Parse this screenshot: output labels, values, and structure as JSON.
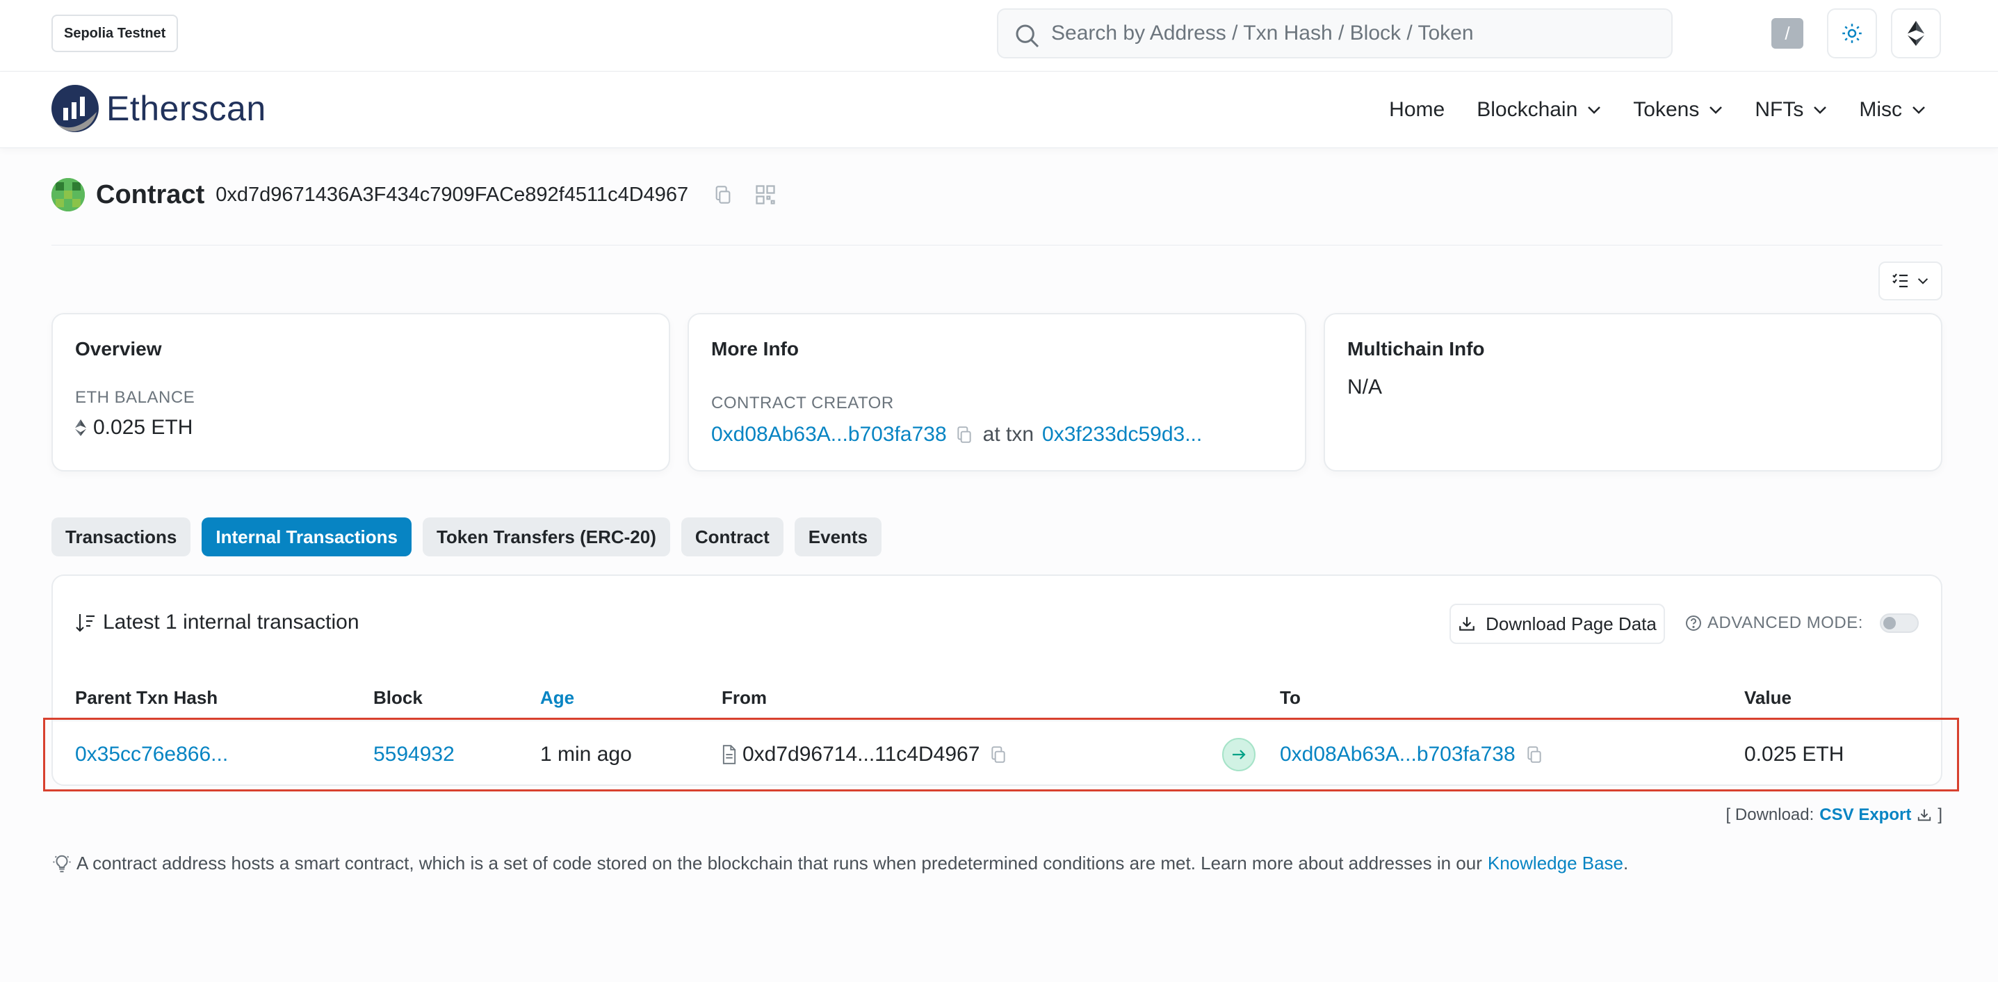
{
  "topbar": {
    "network": "Sepolia Testnet",
    "search_placeholder": "Search by Address / Txn Hash / Block / Token",
    "search_shortcut": "/"
  },
  "nav": {
    "brand": "Etherscan",
    "items": [
      {
        "label": "Home"
      },
      {
        "label": "Blockchain"
      },
      {
        "label": "Tokens"
      },
      {
        "label": "NFTs"
      },
      {
        "label": "Misc"
      }
    ]
  },
  "header": {
    "title": "Contract",
    "address": "0xd7d9671436A3F434c7909FACe892f4511c4D4967"
  },
  "overview": {
    "title": "Overview",
    "balance_label": "ETH BALANCE",
    "balance_value": "0.025 ETH"
  },
  "more_info": {
    "title": "More Info",
    "creator_label": "CONTRACT CREATOR",
    "creator_address": "0xd08Ab63A...b703fa738",
    "at_txn": "at txn",
    "txn_hash": "0x3f233dc59d3..."
  },
  "multichain": {
    "title": "Multichain Info",
    "value": "N/A"
  },
  "tabs": [
    {
      "label": "Transactions",
      "active": false
    },
    {
      "label": "Internal Transactions",
      "active": true
    },
    {
      "label": "Token Transfers (ERC-20)",
      "active": false
    },
    {
      "label": "Contract",
      "active": false
    },
    {
      "label": "Events",
      "active": false
    }
  ],
  "table": {
    "summary": "Latest 1 internal transaction",
    "download_label": "Download Page Data",
    "advanced_mode_label": "ADVANCED MODE:",
    "columns": [
      "Parent Txn Hash",
      "Block",
      "Age",
      "From",
      "To",
      "Value"
    ],
    "rows": [
      {
        "parent_txn_hash": "0x35cc76e866...",
        "block": "5594932",
        "age": "1 min ago",
        "from": "0xd7d96714...11c4D4967",
        "to": "0xd08Ab63A...b703fa738",
        "value": "0.025 ETH"
      }
    ]
  },
  "csv": {
    "prefix": "[ Download:",
    "link": "CSV Export",
    "suffix": "]"
  },
  "footer_note": {
    "text": "A contract address hosts a smart contract, which is a set of code stored on the blockchain that runs when predetermined conditions are met. Learn more about addresses in our",
    "link": "Knowledge Base",
    "end": "."
  },
  "colors": {
    "accent": "#0784c3",
    "highlight_border": "#d8412f",
    "brand_dark": "#21325b"
  }
}
